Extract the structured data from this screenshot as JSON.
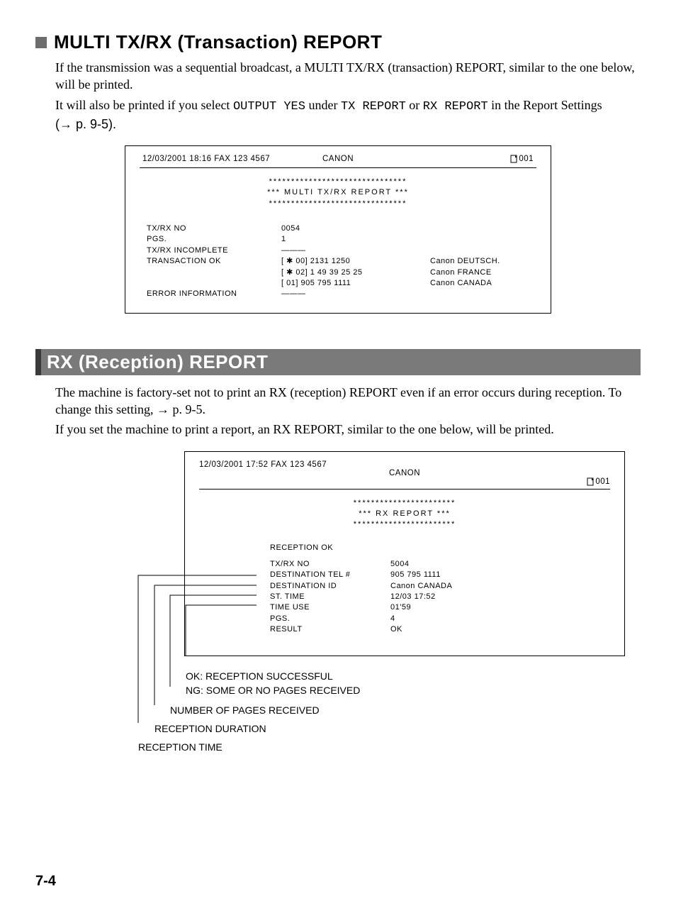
{
  "section1": {
    "title": "MULTI TX/RX (Transaction) REPORT",
    "para1": "If the transmission was a sequential broadcast, a MULTI TX/RX (transaction) REPORT, similar to the one below, will be printed.",
    "para2a": "It will also be printed if you select ",
    "para2_mono1": "OUTPUT YES",
    "para2b": " under ",
    "para2_mono2": "TX REPORT",
    "para2c": " or ",
    "para2_mono3": "RX REPORT",
    "para2d": " in the Report Settings ",
    "para2_arrow": "(→ p. 9-5)."
  },
  "report1": {
    "hdr_left": "12/03/2001  18:16  FAX 123 4567",
    "hdr_center": "CANON",
    "hdr_right": "001",
    "stars_row": "*******************************",
    "title": "***    MULTI TX/RX REPORT    ***",
    "rows": {
      "l1": "TX/RX NO",
      "v1": "0054",
      "l2": "PGS.",
      "v2": "  1",
      "l3": "TX/RX INCOMPLETE",
      "v3": "———",
      "l4": "TRANSACTION OK",
      "v4a": "[ ✱ 00] 2131 1250",
      "r4a": "Canon DEUTSCH.",
      "v4b": "[ ✱ 02] 1 49 39 25 25",
      "r4b": "Canon FRANCE",
      "v4c": "[     01] 905 795 1111",
      "r4c": "Canon CANADA",
      "l5": "ERROR INFORMATION",
      "v5": "———"
    }
  },
  "section2": {
    "title": "RX (Reception) REPORT",
    "para1": "The machine is factory-set not to print an RX (reception) REPORT even if an error occurs during reception. To change this setting, → p. 9-5.",
    "para2": "If you set the machine to print a report, an RX REPORT, similar to the one below, will be printed."
  },
  "report2": {
    "hdr_left": "12/03/2001  17:52  FAX 123 4567",
    "hdr_center": "CANON",
    "hdr_right": "001",
    "stars_row": "***********************",
    "title": "***    RX REPORT    ***",
    "status": "RECEPTION OK",
    "rows": {
      "l1": "TX/RX NO",
      "v1": "5004",
      "l2": "DESTINATION TEL #",
      "v2": "905 795 1111",
      "l3": "DESTINATION ID",
      "v3": "Canon CANADA",
      "l4": "ST. TIME",
      "v4": "12/03 17:52",
      "l5": "TIME USE",
      "v5": "01'59",
      "l6": "PGS.",
      "v6": "  4",
      "l7": "RESULT",
      "v7": "OK"
    }
  },
  "callouts": {
    "c1a": "OK:  RECEPTION SUCCESSFUL",
    "c1b": "NG:  SOME OR NO PAGES RECEIVED",
    "c2": "NUMBER OF PAGES RECEIVED",
    "c3": "RECEPTION DURATION",
    "c4": "RECEPTION TIME"
  },
  "page_num": "7-4"
}
